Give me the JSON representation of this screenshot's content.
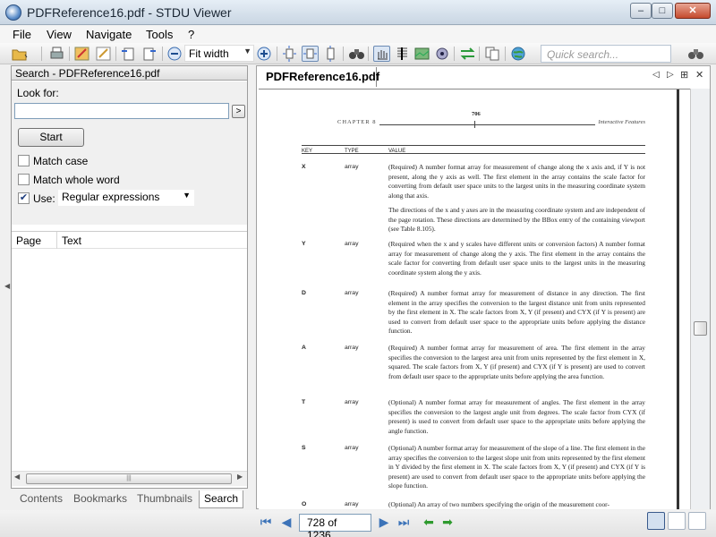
{
  "window": {
    "title": "PDFReference16.pdf - STDU Viewer",
    "min": "–",
    "max": "□",
    "close": "✕"
  },
  "menu": [
    "File",
    "View",
    "Navigate",
    "Tools",
    "?"
  ],
  "toolbar": {
    "zoom": "Fit width",
    "quick_search_placeholder": "Quick search..."
  },
  "left_panel": {
    "title": "Search - PDFReference16.pdf",
    "look_for_label": "Look for:",
    "look_for_value": "",
    "go": ">",
    "start": "Start",
    "match_case": {
      "label": "Match case",
      "checked": false
    },
    "match_whole_word": {
      "label": "Match whole word",
      "checked": false
    },
    "use": {
      "label": "Use:",
      "checked": true,
      "value": "Regular expressions"
    },
    "results_columns": [
      "Page",
      "Text"
    ],
    "tabs": [
      "Contents",
      "Bookmarks",
      "Thumbnails",
      "Search"
    ],
    "active_tab": "Search"
  },
  "document": {
    "tab_title": "PDFReference16.pdf",
    "header": {
      "chapter": "CHAPTER 8",
      "page": "706",
      "section": "Interactive Features"
    },
    "columns": [
      "KEY",
      "TYPE",
      "VALUE"
    ],
    "rows": [
      {
        "key": "X",
        "type": "array",
        "value": "(Required) A number format array for measurement of change along the x axis and, if Y is not present, along the y axis as well. The first element in the array contains the scale factor for converting from default user space units to the largest units in the measuring coordinate system along that axis.",
        "extra": "The directions of the x and y axes are in the measuring coordinate system and are independent of the page rotation. These directions are determined by the BBox entry of the containing viewport (see Table 8.105)."
      },
      {
        "key": "Y",
        "type": "array",
        "value": "(Required when the x and y scales have different units or conversion factors) A number format array for measurement of change along the y axis. The first element in the array contains the scale factor for converting from default user space units to the largest units in the measuring coordinate system along the y axis."
      },
      {
        "key": "D",
        "type": "array",
        "value": "(Required) A number format array for measurement of distance in any direction. The first element in the array specifies the conversion to the largest distance unit from units represented by the first element in X. The scale factors from X, Y (if present) and CYX (if Y is present) are used to convert from default user space to the appropriate units before applying the distance function."
      },
      {
        "key": "A",
        "type": "array",
        "value": "(Required) A number format array for measurement of area. The first element in the array specifies the conversion to the largest area unit from units represented by the first element in X, squared. The scale factors from X, Y (if present) and CYX (if Y is present) are used to convert from default user space to the appropriate units before applying the area function."
      },
      {
        "key": "T",
        "type": "array",
        "value": "(Optional) A number format array for measurement of angles. The first element in the array specifies the conversion to the largest angle unit from degrees. The scale factor from CYX (if present) is used to convert from default user space to the appropriate units before applying the angle function."
      },
      {
        "key": "S",
        "type": "array",
        "value": "(Optional) A number format array for measurement of the slope of a line. The first element in the array specifies the conversion to the largest slope unit from units represented by the first element in Y divided by the first element in X. The scale factors from X, Y (if present) and CYX (if Y is present) are used to convert from default user space to the appropriate units before applying the slope function."
      },
      {
        "key": "O",
        "type": "array",
        "value": "(Optional) An array of two numbers specifying the origin of the measurement coor-"
      }
    ]
  },
  "status": {
    "page_indicator": "728 of 1236"
  }
}
